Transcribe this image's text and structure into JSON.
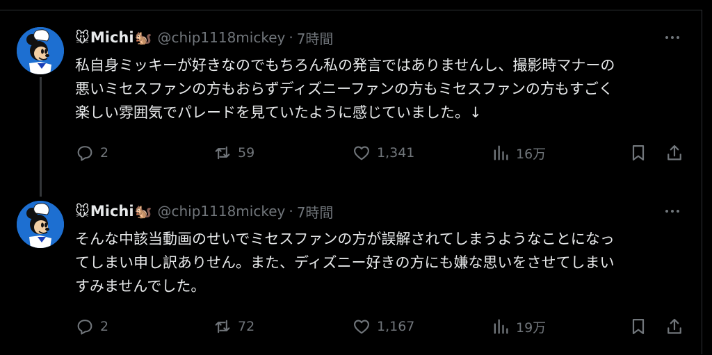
{
  "tweets": [
    {
      "name_prefix_emoji": "🐭",
      "display_name": "Michi",
      "name_suffix_emoji": "🐿️",
      "handle": "@chip1118mickey",
      "separator": "·",
      "time": "7時間",
      "text": "私自身ミッキーが好きなのでもちろん私の発言ではありませんし、撮影時マナーの\n悪いミセスファンの方もおらずディズニーファンの方もミセスファンの方もすごく\n楽しい雰囲気でパレードを見ていたように感じていました。↓",
      "stats": {
        "replies": "2",
        "reposts": "59",
        "likes": "1,341",
        "views": "16万"
      }
    },
    {
      "name_prefix_emoji": "🐭",
      "display_name": "Michi",
      "name_suffix_emoji": "🐿️",
      "handle": "@chip1118mickey",
      "separator": "·",
      "time": "7時間",
      "text": "そんな中該当動画のせいでミセスファンの方が誤解されてしまうようなことになっ\nてしまい申し訳ありせん。また、ディズニー好きの方にも嫌な思いをさせてしまい\nすみませんでした。",
      "stats": {
        "replies": "2",
        "reposts": "72",
        "likes": "1,167",
        "views": "19万"
      }
    }
  ],
  "icons": {
    "reply": "speech-bubble-icon",
    "repost": "repost-arrows-icon",
    "like": "heart-icon",
    "views": "bar-chart-icon",
    "bookmark": "bookmark-icon",
    "share": "share-upload-icon",
    "more": "more-dots-icon"
  },
  "colors": {
    "background": "#000000",
    "text": "#e7e9ea",
    "muted": "#71767b",
    "avatar_bg": "#1d6fd1"
  }
}
